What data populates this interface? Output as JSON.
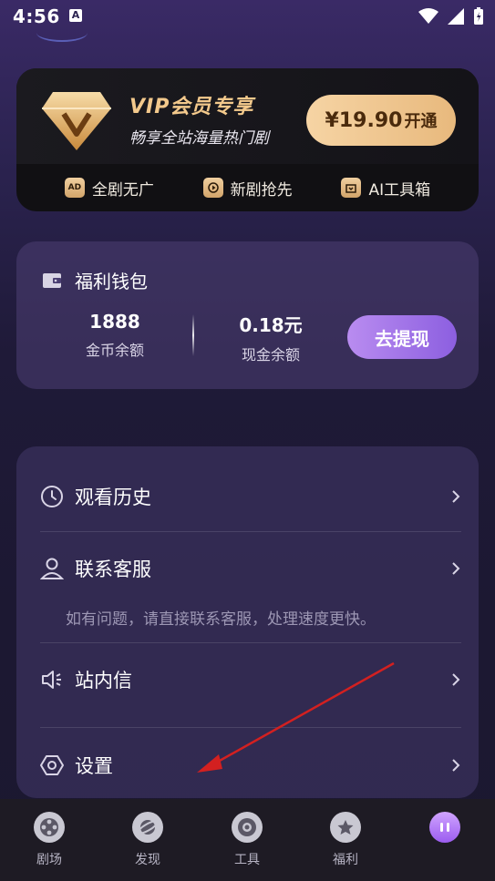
{
  "status": {
    "time": "4:56",
    "a_badge": "A"
  },
  "vip": {
    "title": "VIP会员专享",
    "subtitle": "畅享全站海量热门剧",
    "price": "¥19.90",
    "open_label": "开通",
    "features": [
      "全剧无广",
      "新剧抢先",
      "AI工具箱"
    ],
    "feature_badge_ad": "AD"
  },
  "wallet": {
    "title": "福利钱包",
    "coins_value": "1888",
    "coins_label": "金币余额",
    "cash_value": "0.18元",
    "cash_label": "现金余额",
    "withdraw_label": "去提现"
  },
  "menu": {
    "history": "观看历史",
    "service": "联系客服",
    "service_note": "如有问题，请直接联系客服，处理速度更快。",
    "inbox": "站内信",
    "settings": "设置"
  },
  "tabs": [
    "剧场",
    "发现",
    "工具",
    "福利"
  ],
  "colors": {
    "accent_purple": "#9b5cf0",
    "gold": "#f3c98c",
    "annotation_arrow": "#d32020"
  }
}
